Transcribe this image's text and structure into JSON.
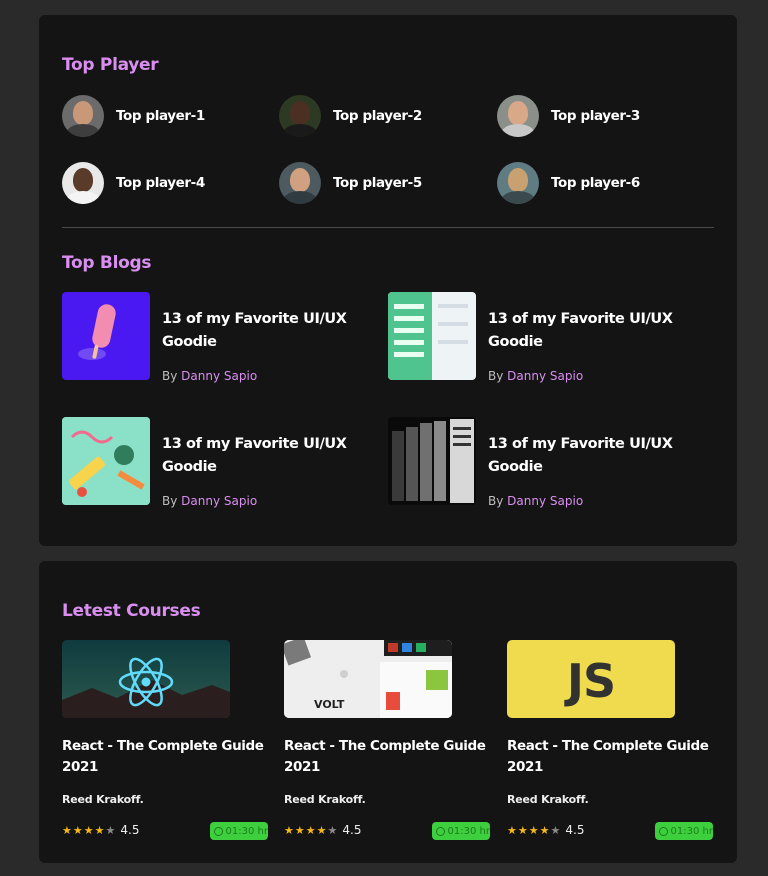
{
  "top_player": {
    "title": "Top Player",
    "players": [
      {
        "name": "Top player-1",
        "icon": "avatar-icon"
      },
      {
        "name": "Top player-2",
        "icon": "avatar-icon"
      },
      {
        "name": "Top player-3",
        "icon": "avatar-icon"
      },
      {
        "name": "Top player-4",
        "icon": "avatar-icon"
      },
      {
        "name": "Top player-5",
        "icon": "avatar-icon"
      },
      {
        "name": "Top player-6",
        "icon": "avatar-icon"
      }
    ]
  },
  "top_blogs": {
    "title": "Top Blogs",
    "posts": [
      {
        "title": "13 of my Favorite UI/UX Goodie",
        "by": "By",
        "author": "Danny Sapio"
      },
      {
        "title": "13 of my Favorite UI/UX Goodie",
        "by": "By",
        "author": "Danny Sapio"
      },
      {
        "title": "13 of my Favorite UI/UX Goodie",
        "by": "By",
        "author": "Danny Sapio"
      },
      {
        "title": "13 of my Favorite UI/UX Goodie",
        "by": "By",
        "author": "Danny Sapio"
      }
    ]
  },
  "courses": {
    "title": "Letest Courses",
    "items": [
      {
        "title": "React - The Complete Guide 2021",
        "author": "Reed Krakoff.",
        "rating": "4.5",
        "stars": 4,
        "duration": "01:30 hr",
        "thumb_text": ""
      },
      {
        "title": "React - The Complete Guide 2021",
        "author": "Reed Krakoff.",
        "rating": "4.5",
        "stars": 4,
        "duration": "01:30 hr",
        "thumb_text": "VOLT"
      },
      {
        "title": "React - The Complete Guide 2021",
        "author": "Reed Krakoff.",
        "rating": "4.5",
        "stars": 4,
        "duration": "01:30 hr",
        "thumb_text": "JS"
      }
    ]
  },
  "colors": {
    "accent": "#d98ef0",
    "card": "#141414",
    "background": "#2a2a2a",
    "badge": "#3ecf3e",
    "star": "#f5b817"
  }
}
